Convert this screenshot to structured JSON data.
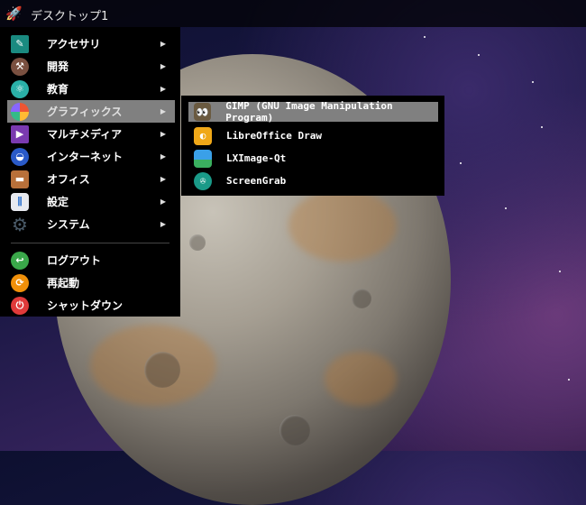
{
  "panel": {
    "title": "デスクトップ1",
    "icon": "rocket-icon"
  },
  "menu": {
    "items": [
      {
        "label": "アクセサリ",
        "icon": "accessories-icon",
        "submenu": true
      },
      {
        "label": "開発",
        "icon": "development-icon",
        "submenu": true
      },
      {
        "label": "教育",
        "icon": "education-icon",
        "submenu": true
      },
      {
        "label": "グラフィックス",
        "icon": "graphics-icon",
        "submenu": true,
        "selected": true
      },
      {
        "label": "マルチメディア",
        "icon": "multimedia-icon",
        "submenu": true
      },
      {
        "label": "インターネット",
        "icon": "internet-icon",
        "submenu": true
      },
      {
        "label": "オフィス",
        "icon": "office-icon",
        "submenu": true
      },
      {
        "label": "設定",
        "icon": "settings-icon",
        "submenu": true
      },
      {
        "label": "システム",
        "icon": "system-icon",
        "submenu": true
      }
    ],
    "actions": [
      {
        "label": "ログアウト",
        "icon": "logout-icon"
      },
      {
        "label": "再起動",
        "icon": "reboot-icon"
      },
      {
        "label": "シャットダウン",
        "icon": "shutdown-icon"
      }
    ]
  },
  "submenu": {
    "items": [
      {
        "label": "GIMP (GNU Image Manipulation Program)",
        "icon": "gimp-icon",
        "selected": true
      },
      {
        "label": "LibreOffice Draw",
        "icon": "libreoffice-draw-icon"
      },
      {
        "label": "LXImage-Qt",
        "icon": "lximage-icon"
      },
      {
        "label": "ScreenGrab",
        "icon": "screengrab-icon"
      }
    ]
  }
}
